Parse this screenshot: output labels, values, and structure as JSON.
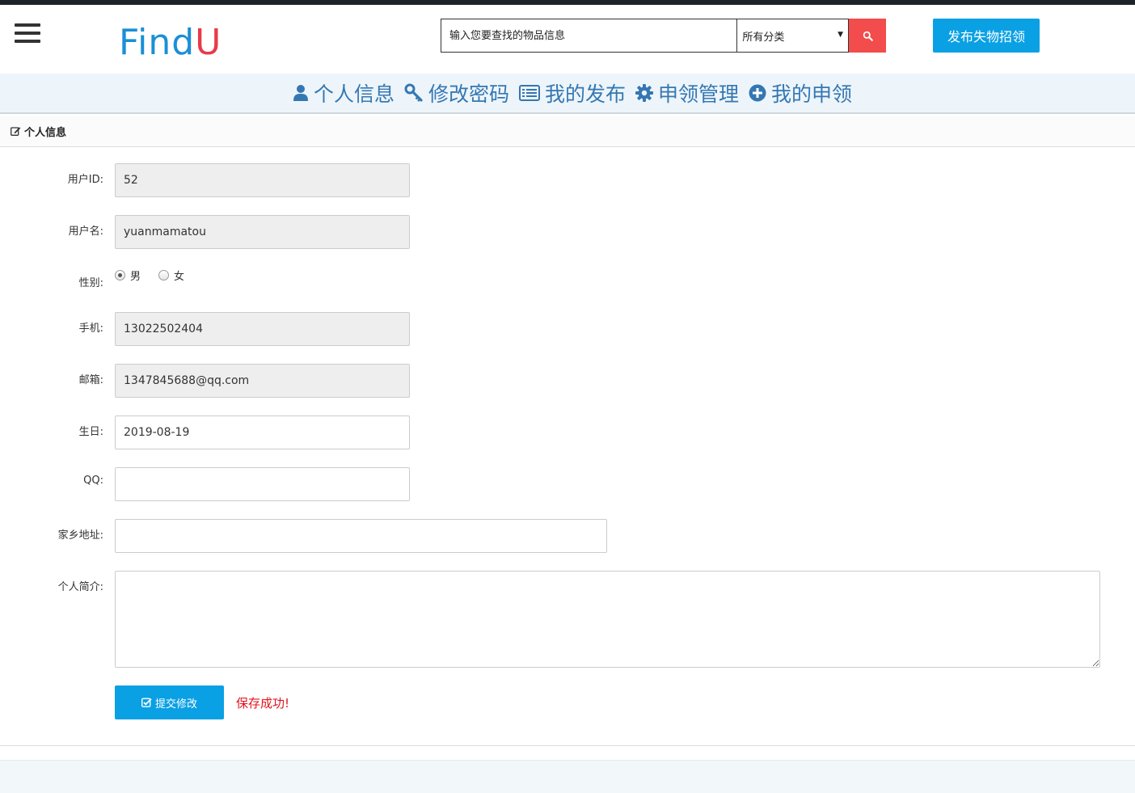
{
  "header": {
    "logo_part1": "Find",
    "logo_part2": "U",
    "search_placeholder": "输入您要查找的物品信息",
    "category_selected": "所有分类",
    "publish_label": "发布失物招领"
  },
  "nav": {
    "items": [
      {
        "label": "个人信息",
        "icon": "user-icon"
      },
      {
        "label": "修改密码",
        "icon": "key-icon"
      },
      {
        "label": "我的发布",
        "icon": "list-icon"
      },
      {
        "label": "申领管理",
        "icon": "gear-icon"
      },
      {
        "label": "我的申领",
        "icon": "plus-circle-icon"
      }
    ]
  },
  "section": {
    "title": "个人信息",
    "icon": "edit-icon"
  },
  "form": {
    "user_id_label": "用户ID:",
    "user_id_value": "52",
    "username_label": "用户名:",
    "username_value": "yuanmamatou",
    "gender_label": "性别:",
    "gender_male": "男",
    "gender_female": "女",
    "gender_selected": "男",
    "phone_label": "手机:",
    "phone_value": "13022502404",
    "email_label": "邮箱:",
    "email_value": "1347845688@qq.com",
    "birthday_label": "生日:",
    "birthday_value": "2019-08-19",
    "qq_label": "QQ:",
    "qq_value": "",
    "hometown_label": "家乡地址:",
    "hometown_value": "",
    "bio_label": "个人简介:",
    "bio_value": "",
    "submit_label": "提交修改",
    "success_message": "保存成功!"
  },
  "colors": {
    "brand_blue": "#1a8fd6",
    "brand_red": "#e83a4a",
    "nav_text": "#3577b2",
    "button_blue": "#0aa0e4",
    "search_red": "#f24c4c",
    "success_red": "#e0141e"
  }
}
